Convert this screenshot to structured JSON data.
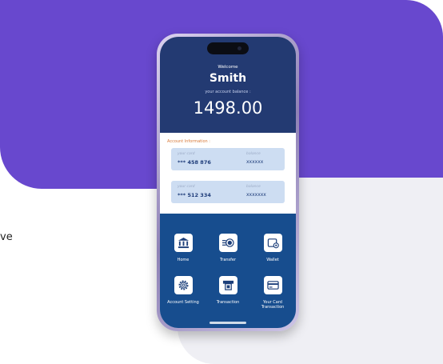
{
  "side_text": "ve",
  "phone": {
    "welcome": "Welcome",
    "name": "Smith",
    "balance_label": "your account balance :",
    "balance_value": "1498.00",
    "account_info_title": "Account Information :",
    "cards": [
      {
        "card_label": "your card",
        "card_number": "*** 458 876",
        "balance_label": "balance",
        "balance_value": "xxxxxx"
      },
      {
        "card_label": "your card",
        "card_number": "*** 512 334",
        "balance_label": "balance",
        "balance_value": "xxxxxxx"
      }
    ],
    "menu": [
      {
        "label": "Home",
        "icon": "bank-icon"
      },
      {
        "label": "Transfer",
        "icon": "transfer-coin-icon"
      },
      {
        "label": "Wallet",
        "icon": "wallet-icon"
      },
      {
        "label": "Account Setting",
        "icon": "gear-icon"
      },
      {
        "label": "Transaction",
        "icon": "atm-icon"
      },
      {
        "label": "Your Card Transaction",
        "icon": "credit-card-icon"
      }
    ]
  },
  "colors": {
    "purple": "#6848ce",
    "navy": "#233a72",
    "menu_blue": "#174d8e",
    "card_bg": "#cdddf2",
    "accent_orange": "#d87a3a"
  }
}
